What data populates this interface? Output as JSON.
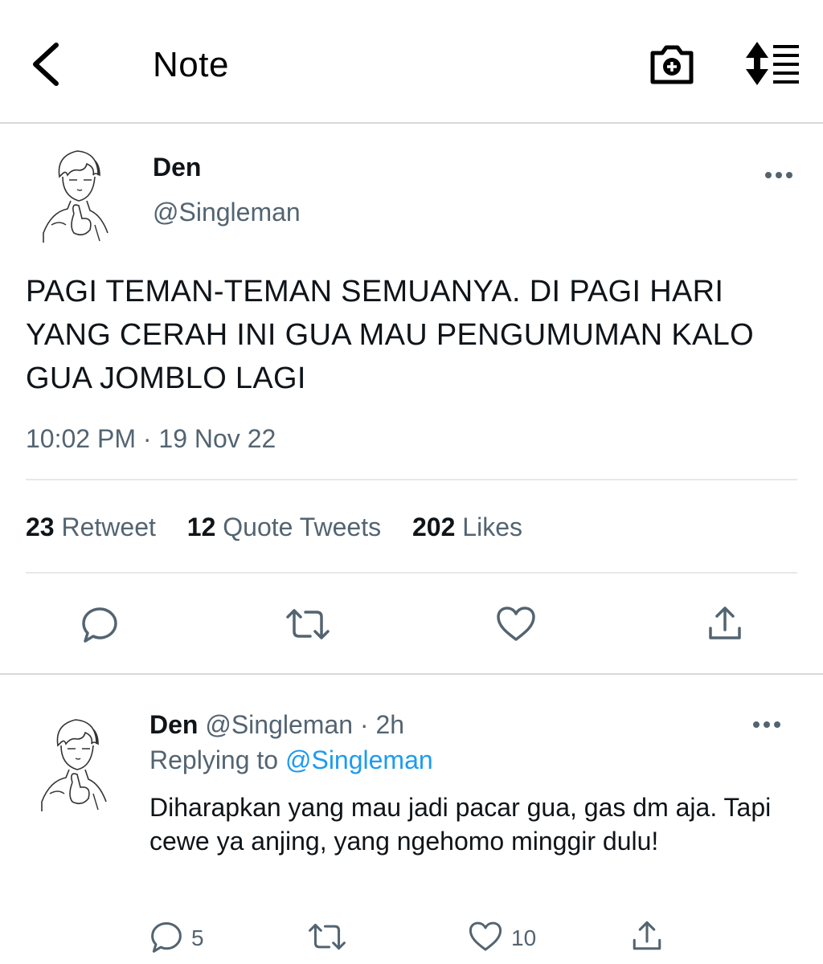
{
  "header": {
    "title": "Note"
  },
  "tweet": {
    "author_name": "Den",
    "author_handle": "@Singleman",
    "text": "PAGI TEMAN-TEMAN SEMUANYA. DI PAGI HARI YANG CERAH INI GUA MAU PENGUMUMAN KALO GUA JOMBLO LAGI",
    "timestamp": "10:02 PM · 19 Nov 22",
    "stats": {
      "retweets_count": "23",
      "retweets_label": "Retweet",
      "quotes_count": "12",
      "quotes_label": "Quote Tweets",
      "likes_count": "202",
      "likes_label": "Likes"
    }
  },
  "reply": {
    "author_name": "Den",
    "author_handle": "@Singleman",
    "time": "· 2h",
    "replying_label": "Replying to",
    "replying_to": "@Singleman",
    "text": "Diharapkan yang mau jadi pacar gua, gas dm aja. Tapi cewe ya anjing, yang ngehomo minggir dulu!",
    "reply_count": "5",
    "like_count": "10"
  },
  "icons": {
    "back": "chevron-left-icon",
    "camera": "camera-plus-icon",
    "sort": "sort-lines-icon",
    "more": "more-dots-icon",
    "reply": "comment-icon",
    "retweet": "retweet-icon",
    "like": "heart-icon",
    "share": "share-icon"
  },
  "colors": {
    "text": "#0f1419",
    "secondary": "#536471",
    "link": "#1d9bf0",
    "divider": "#e6e9eb"
  }
}
